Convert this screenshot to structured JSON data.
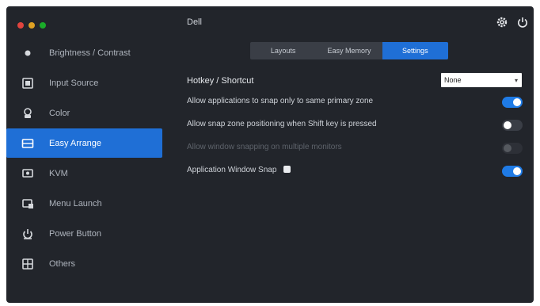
{
  "window": {
    "title": "Dell",
    "controls": [
      "#e0443e",
      "#dea123",
      "#1aab29"
    ],
    "top_icons": [
      "gear-icon",
      "power-icon"
    ]
  },
  "sidebar": {
    "items": [
      {
        "label": "Brightness / Contrast",
        "icon": "brightness-icon",
        "active": false
      },
      {
        "label": "Input Source",
        "icon": "input-source-icon",
        "active": false
      },
      {
        "label": "Color",
        "icon": "color-icon",
        "active": false
      },
      {
        "label": "Easy Arrange",
        "icon": "easy-arrange-icon",
        "active": true
      },
      {
        "label": "KVM",
        "icon": "kvm-icon",
        "active": false
      },
      {
        "label": "Menu Launch",
        "icon": "menu-launch-icon",
        "active": false
      },
      {
        "label": "Power Button",
        "icon": "power-button-icon",
        "active": false
      },
      {
        "label": "Others",
        "icon": "others-icon",
        "active": false
      }
    ]
  },
  "tabs": [
    {
      "label": "Layouts",
      "active": false
    },
    {
      "label": "Easy Memory",
      "active": false
    },
    {
      "label": "Settings",
      "active": true
    }
  ],
  "settings": {
    "hotkey_label": "Hotkey / Shortcut",
    "hotkey_value": "None",
    "options": [
      {
        "label": "Allow applications to snap only to same primary zone",
        "state": "on"
      },
      {
        "label": "Allow snap zone positioning when Shift key is pressed",
        "state": "off"
      },
      {
        "label": "Allow window snapping on multiple monitors",
        "state": "disabled"
      },
      {
        "label": "Application Window Snap",
        "state": "on"
      }
    ]
  },
  "colors": {
    "accent": "#1f6fd6",
    "background": "#22252b"
  }
}
